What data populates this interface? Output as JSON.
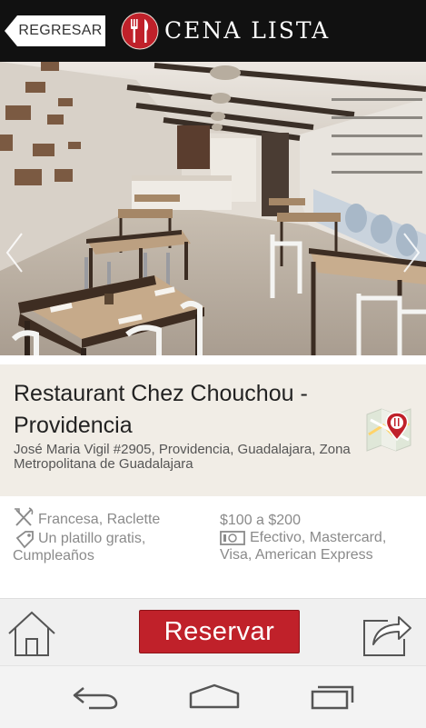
{
  "header": {
    "back_label": "REGRESAR",
    "app_title": "CENA LISTA"
  },
  "restaurant": {
    "name": "Restaurant Chez Chouchou - Providencia",
    "address": "José Maria Vigil #2905, Providencia, Guadalajara, Zona Metropolitana de Guadalajara"
  },
  "details": {
    "cuisine": "Francesa, Raclette",
    "promo": "Un platillo gratis, Cumpleaños",
    "price_range": "$100 a $200",
    "payment_methods": "Efectivo, Mastercard, Visa, American Express"
  },
  "toolbar": {
    "reserve_label": "Reservar"
  },
  "colors": {
    "accent": "#c0212a",
    "topbar": "#111111",
    "info_background": "#f1ede6"
  },
  "icons": {
    "back": "back-arrow-tag-icon",
    "logo": "fork-knife-plate-icon",
    "map": "map-pin-icon",
    "cuisine": "utensils-icon",
    "promo": "tag-icon",
    "payment": "banknote-icon",
    "home": "home-icon",
    "share": "share-arrow-icon",
    "nav_back": "nav-back-icon",
    "nav_home": "nav-home-icon",
    "nav_recents": "nav-recents-icon"
  }
}
